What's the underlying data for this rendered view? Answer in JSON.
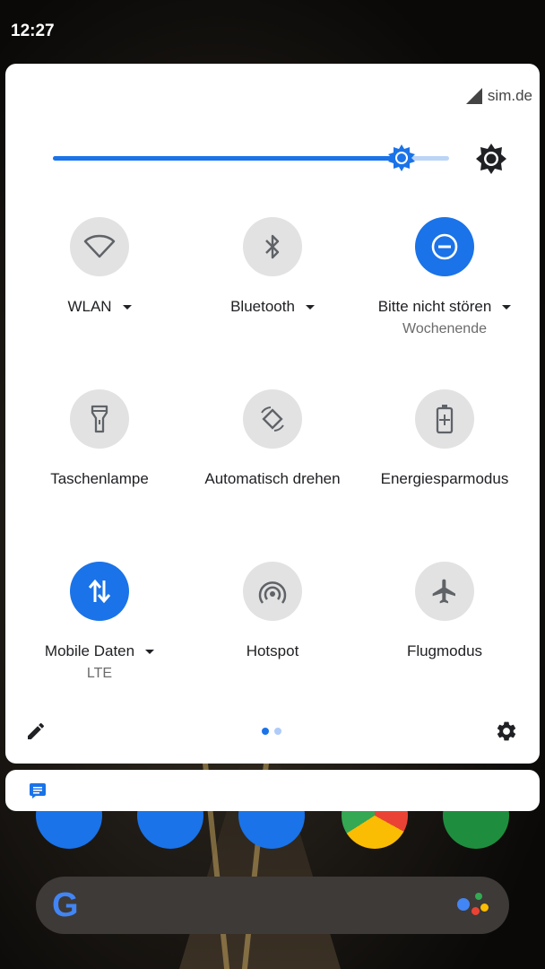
{
  "status_bar": {
    "time": "12:27"
  },
  "carrier": {
    "name": "sim.de"
  },
  "brightness": {
    "level": 0.88
  },
  "tiles": [
    {
      "label": "WLAN",
      "sub": "",
      "on": false,
      "has_menu": true,
      "icon": "wifi-icon"
    },
    {
      "label": "Bluetooth",
      "sub": "",
      "on": false,
      "has_menu": true,
      "icon": "bluetooth-icon"
    },
    {
      "label": "Bitte nicht stören",
      "sub": "Wochenende",
      "on": true,
      "has_menu": true,
      "icon": "do-not-disturb-icon"
    },
    {
      "label": "Taschenlampe",
      "sub": "",
      "on": false,
      "has_menu": false,
      "icon": "flashlight-icon"
    },
    {
      "label": "Automatisch drehen",
      "sub": "",
      "on": false,
      "has_menu": false,
      "icon": "auto-rotate-icon"
    },
    {
      "label": "Energiesparmodus",
      "sub": "",
      "on": false,
      "has_menu": false,
      "icon": "battery-saver-icon"
    },
    {
      "label": "Mobile Daten",
      "sub": "LTE",
      "on": true,
      "has_menu": true,
      "icon": "mobile-data-icon"
    },
    {
      "label": "Hotspot",
      "sub": "",
      "on": false,
      "has_menu": false,
      "icon": "hotspot-icon"
    },
    {
      "label": "Flugmodus",
      "sub": "",
      "on": false,
      "has_menu": false,
      "icon": "airplane-icon"
    }
  ],
  "pager": {
    "pages": 2,
    "current": 1
  },
  "colors": {
    "accent": "#1a73e8",
    "tile_off": "#e2e2e2",
    "panel": "#ffffff"
  }
}
